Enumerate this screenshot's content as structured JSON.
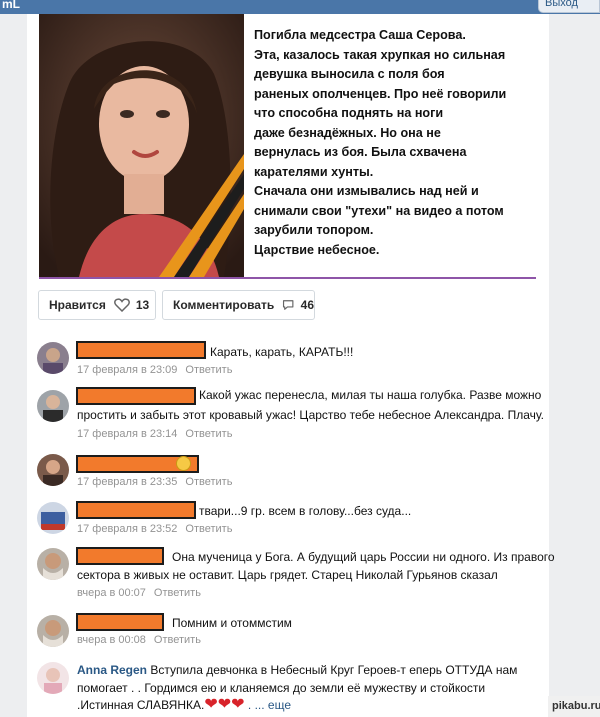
{
  "topbar": {
    "brand": "mL",
    "corner_button": "Выход"
  },
  "post": {
    "lines": [
      "Погибла медсестра Саша Серова.",
      "Эта, казалось такая хрупкая но сильная",
      "девушка выносила с поля боя",
      "раненых ополченцев. Про неё говорили",
      "что способна поднять на ноги",
      "даже безнадёжных. Но она не",
      "вернулась из боя. Была схвачена",
      "карателями хунты.",
      "Сначала они измывались над ней и",
      "снимали свои \"утехи\" на видео а потом",
      "зарубили топором.",
      "Царствие небесное."
    ],
    "accent_color": "#8e55a8"
  },
  "actions": {
    "like_label": "Нравится",
    "like_count": "13",
    "comment_label": "Комментировать",
    "comment_count": "46"
  },
  "comments": [
    {
      "text": "Карать, карать, КАРАТЬ!!!",
      "date": "17 февраля в 23:09",
      "reply": "Ответить"
    },
    {
      "text_line1": "Какой ужас перенесла, милая ты наша голубка. Разве можно",
      "text_line2": "простить и забыть этот кровавый ужас! Царство тебе небесное Александра. Плачу.",
      "date": "17 февраля в 23:14",
      "reply": "Ответить"
    },
    {
      "date": "17 февраля в 23:35",
      "reply": "Ответить"
    },
    {
      "text": "твари...9 гр. всем в голову...без суда...",
      "date": "17 февраля в 23:52",
      "reply": "Ответить"
    },
    {
      "text_line1": "Она мученица у Бога. А будущий царь России ни одного. Из правого",
      "text_line2": "сектора в живых не оставит. Царь грядет. Старец Николай Гурьянов сказал",
      "date": "вчера в 00:07",
      "reply": "Ответить"
    },
    {
      "text": "Помним и отоммстим",
      "date": "вчера в 00:08",
      "reply": "Ответить"
    },
    {
      "author": "Anna Regen",
      "text_line1": " Вступила девчонка в Небесный Круг Героев-т еперь ОТТУДА нам",
      "text_line2": "помогает . . Гордимся ею и кланяемся до земли её мужеству и стойкости",
      "text_line3": ".Истинная СЛАВЯНКА.",
      "more": " . ... еще"
    }
  ],
  "watermark": "pikabu.ru"
}
